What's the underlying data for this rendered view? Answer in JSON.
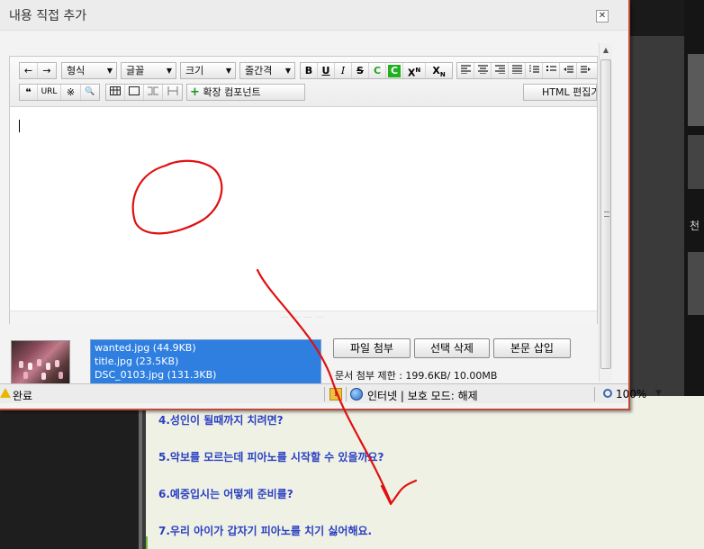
{
  "window": {
    "title": "내용 직접 추가",
    "close_glyph": "✕"
  },
  "toolbar": {
    "undo": "←",
    "redo": "→",
    "format": "형식",
    "font": "글꼴",
    "size": "크기",
    "line_height": "줄간격",
    "bold": "B",
    "underline": "U",
    "italic": "I",
    "strike": "S",
    "text_color": "C",
    "bg_color": "C",
    "superscript": "X",
    "sup_mark": "N",
    "subscript": "X",
    "sub_mark": "N",
    "quote": "❝",
    "url": "URL",
    "special_char": "※",
    "find": "🔍",
    "extend": "확장 컴포넌트",
    "html_edit": "HTML 편집기",
    "dd_caret": "▼"
  },
  "attachments": {
    "files": [
      "wanted.jpg (44.9KB)",
      "title.jpg (23.5KB)",
      "DSC_0103.jpg (131.3KB)"
    ],
    "attach_label": "파일 첨부",
    "delete_label": "선택 삭제",
    "insert_label": "본문 삽입",
    "limit": "문서 첨부 제한 : 199.6KB/ 10.00MB"
  },
  "status_bar": {
    "status": "완료",
    "zone": "인터넷 | 보호 모드: 해제",
    "zoom": "100%",
    "zoom_caret": "▼"
  },
  "background": {
    "faq": [
      "4.성인이 될때까지 치려면?",
      "5.악보를 모르는데 피아노를 시작할 수 있을까요?",
      "6.예중입시는 어떻게 준비를?",
      "7.우리 아이가 갑자기 피아노를 치기 싫어해요."
    ],
    "right_char": "천"
  },
  "colors": {
    "annotation": "#e01010",
    "link_blue": "#2a3fc2",
    "selection": "#2f7fe0"
  }
}
